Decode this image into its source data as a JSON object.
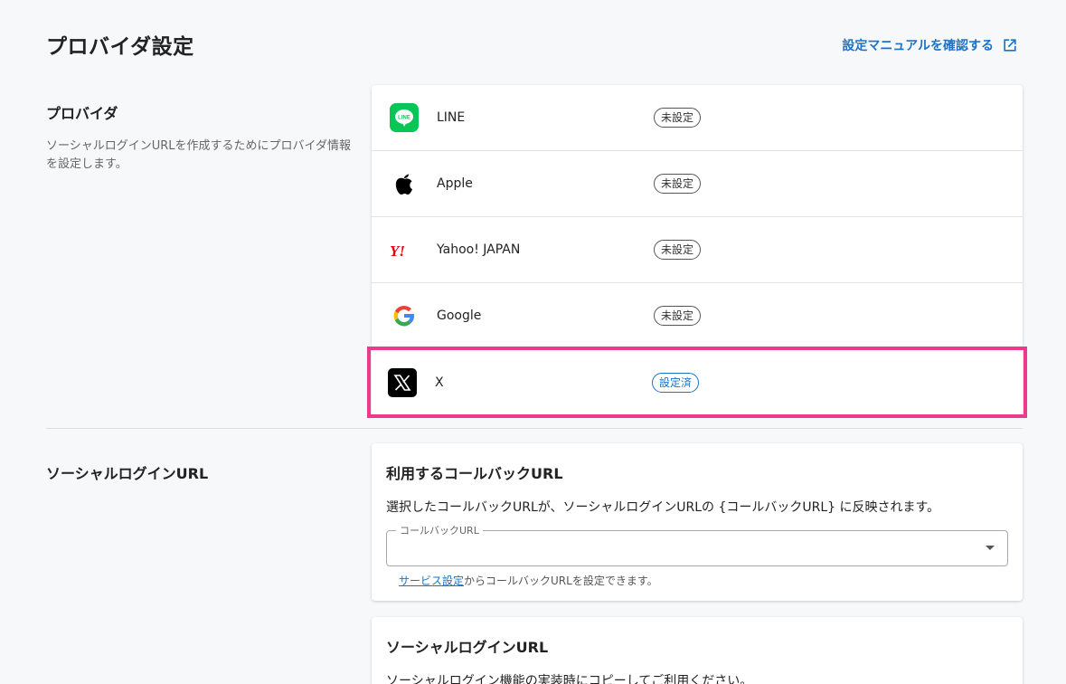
{
  "header": {
    "title": "プロバイダ設定",
    "manual_link": "設定マニュアルを確認する",
    "manual_icon": "open-in-new-icon",
    "accent_color": "#1a73c8"
  },
  "provider_section": {
    "title": "プロバイダ",
    "description": "ソーシャルログインURLを作成するためにプロバイダ情報を設定します。",
    "providers": [
      {
        "name": "LINE",
        "icon": "line-logo-icon",
        "status": "未設定"
      },
      {
        "name": "Apple",
        "icon": "apple-logo-icon",
        "status": "未設定"
      },
      {
        "name": "Yahoo! JAPAN",
        "icon": "yahoo-japan-logo-icon",
        "status": "未設定"
      },
      {
        "name": "Google",
        "icon": "google-logo-icon",
        "status": "未設定"
      },
      {
        "name": "X",
        "icon": "x-logo-icon",
        "status": "設定済"
      }
    ],
    "highlight_color": "#ec3a8d"
  },
  "social_section": {
    "title": "ソーシャルログインURL",
    "callback_card": {
      "title": "利用するコールバックURL",
      "description": "選択したコールバックURLが、ソーシャルログインURLの {コールバックURL} に反映されます。",
      "select_label": "コールバックURL",
      "select_value": "",
      "helper_link": "サービス設定",
      "helper_text": "からコールバックURLを設定できます。"
    },
    "url_card": {
      "title": "ソーシャルログインURL",
      "description": "ソーシャルログイン機能の実装時にコピーしてご利用ください。"
    }
  }
}
